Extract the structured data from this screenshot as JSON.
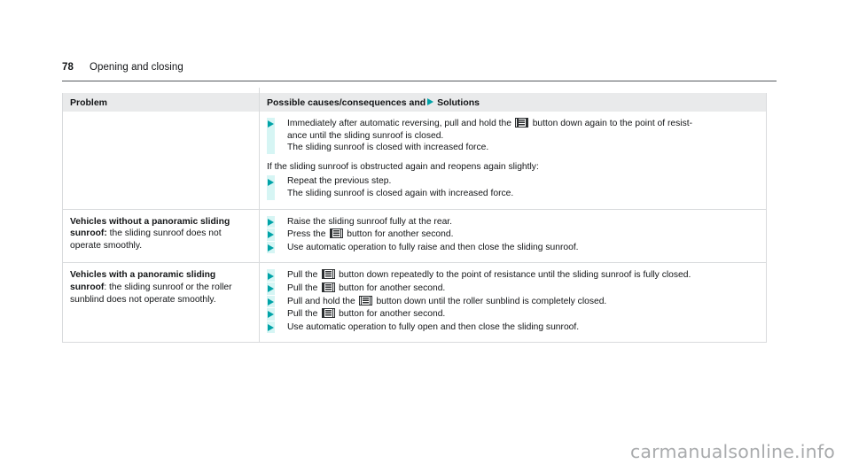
{
  "page": {
    "number": "78",
    "section": "Opening and closing"
  },
  "table": {
    "headers": {
      "problem": "Problem",
      "solutions_prefix": "Possible causes/consequences and",
      "solutions_suffix": "Solutions",
      "triangle_icon": "solution-triangle-icon"
    },
    "rows": [
      {
        "problem": "",
        "blocks": [
          {
            "kind": "bullet",
            "text_part1": "Immediately after automatic reversing, pull and hold the",
            "icon": "sunroof-button-icon",
            "text_part2": "button down again to the point of resist-",
            "text_part3": "ance until the sliding sunroof is closed.",
            "consequence": "The sliding sunroof is closed with increased force."
          },
          {
            "kind": "plain",
            "text": "If the sliding sunroof is obstructed again and reopens again slightly:"
          },
          {
            "kind": "bullet",
            "text_part1": "Repeat the previous step.",
            "icon": null,
            "text_part2": "",
            "text_part3": "",
            "consequence": "The sliding sunroof is closed again with increased force."
          }
        ]
      },
      {
        "problem_bold": "Vehicles without a panoramic sliding sunroof:",
        "problem_rest": " the sliding sunroof does not operate smoothly.",
        "blocks": [
          {
            "kind": "bullet",
            "text_part1": "Raise the sliding sunroof fully at the rear.",
            "icon": null,
            "text_part2": "",
            "text_part3": "",
            "consequence": ""
          },
          {
            "kind": "bullet",
            "text_part1": "Press the",
            "icon": "sunroof-button-icon",
            "text_part2": "button for another second.",
            "text_part3": "",
            "consequence": ""
          },
          {
            "kind": "bullet",
            "text_part1": "Use automatic operation to fully raise and then close the sliding sunroof.",
            "icon": null,
            "text_part2": "",
            "text_part3": "",
            "consequence": ""
          }
        ]
      },
      {
        "problem_bold": "Vehicles with a panoramic sliding sunroof",
        "problem_rest": ": the sliding sunroof or the roller sunblind does not operate smoothly.",
        "blocks": [
          {
            "kind": "bullet",
            "text_part1": "Pull the",
            "icon": "sunroof-button-icon",
            "text_part2": "button down repeatedly to the point of resistance until the sliding sunroof is fully closed.",
            "text_part3": "",
            "consequence": ""
          },
          {
            "kind": "bullet",
            "text_part1": "Pull the",
            "icon": "sunroof-button-icon",
            "text_part2": "button for another second.",
            "text_part3": "",
            "consequence": ""
          },
          {
            "kind": "bullet",
            "text_part1": "Pull and hold the",
            "icon": "sunroof-button-icon",
            "text_part2": "button down until the roller sunblind is completely closed.",
            "text_part3": "",
            "consequence": ""
          },
          {
            "kind": "bullet",
            "text_part1": "Pull the",
            "icon": "sunroof-button-icon",
            "text_part2": "button for another second.",
            "text_part3": "",
            "consequence": ""
          },
          {
            "kind": "bullet",
            "text_part1": "Use automatic operation to fully open and then close the sliding sunroof.",
            "icon": null,
            "text_part2": "",
            "text_part3": "",
            "consequence": ""
          }
        ]
      }
    ]
  },
  "watermark": "carmanualsonline.info",
  "colors": {
    "accent_teal": "#00a3a8",
    "guide_bar": "#d6f5f4",
    "header_bg": "#e9eaeb",
    "border": "#d9dbdd"
  }
}
